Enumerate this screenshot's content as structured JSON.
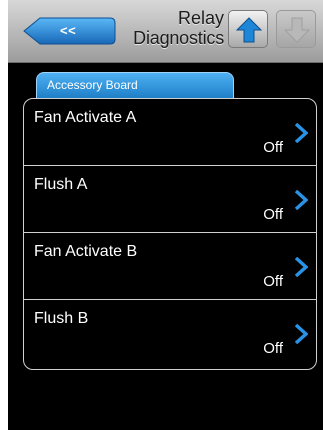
{
  "header": {
    "back_label": "<<",
    "title_line1": "Relay",
    "title_line2": "Diagnostics"
  },
  "tab": {
    "label": "Accessory Board"
  },
  "relays": [
    {
      "label": "Fan Activate A",
      "value": "Off"
    },
    {
      "label": "Flush A",
      "value": "Off"
    },
    {
      "label": "Fan Activate B",
      "value": "Off"
    },
    {
      "label": "Flush B",
      "value": "Off"
    }
  ],
  "colors": {
    "accent": "#1e86d6",
    "background": "#000000",
    "header": "#b5b5b5"
  },
  "icons": {
    "back": "back-arrow-icon",
    "up": "arrow-up-icon",
    "down": "arrow-down-icon",
    "row": "chevron-right-icon"
  }
}
